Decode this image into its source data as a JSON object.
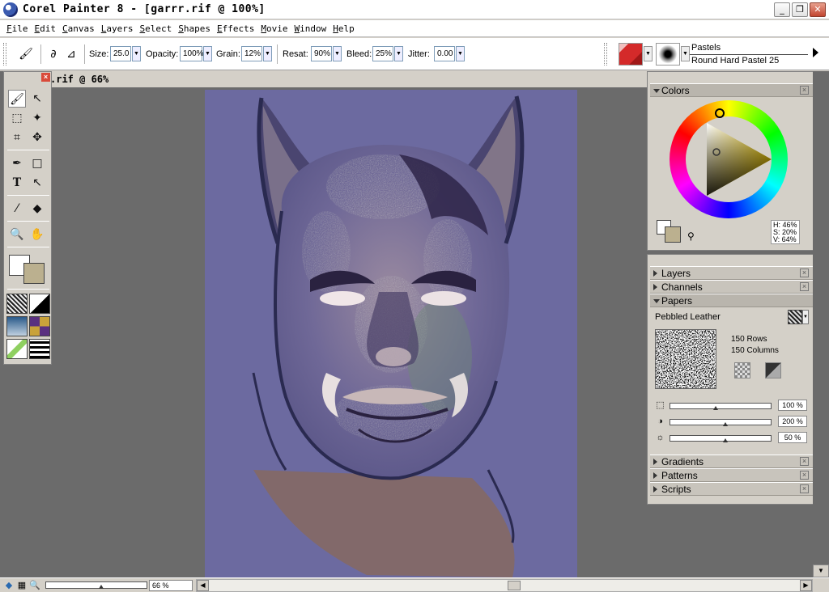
{
  "window": {
    "title": "Corel Painter 8 - [garrr.rif @ 100%]",
    "minimize_label": "_",
    "restore_label": "❐",
    "close_label": "✕"
  },
  "menu": [
    "File",
    "Edit",
    "Canvas",
    "Layers",
    "Select",
    "Shapes",
    "Effects",
    "Movie",
    "Window",
    "Help"
  ],
  "property_bar": {
    "size_label": "Size:",
    "size_value": "25.0",
    "opacity_label": "Opacity:",
    "opacity_value": "100%",
    "grain_label": "Grain:",
    "grain_value": "12%",
    "resat_label": "Resat:",
    "resat_value": "90%",
    "bleed_label": "Bleed:",
    "bleed_value": "25%",
    "jitter_label": "Jitter:",
    "jitter_value": "0.00",
    "brush_category": "Pastels",
    "brush_variant": "Round Hard Pastel 25"
  },
  "document": {
    "title": ".rif @ 66%"
  },
  "colors_palette": {
    "name": "Colors",
    "h": "H: 46%",
    "s": "S: 20%",
    "v": "V: 64%",
    "main_color": "#bbb08f",
    "additional_color": "#ffffff"
  },
  "palettes": {
    "layers": "Layers",
    "channels": "Channels",
    "papers": "Papers",
    "gradients": "Gradients",
    "patterns": "Patterns",
    "scripts": "Scripts"
  },
  "papers": {
    "paper_name": "Pebbled Leather",
    "rows": "150 Rows",
    "columns": "150 Columns",
    "scale_value": "100 %",
    "contrast_value": "200 %",
    "brightness_value": "50 %",
    "scale_level": 0.45,
    "contrast_level": 0.55,
    "brightness_level": 0.55
  },
  "status": {
    "zoom_value": "66 %",
    "zoom_level": 0.55
  },
  "icons": [
    "app-icon",
    "brush-icon",
    "arrow-select-icon",
    "rect-select-icon",
    "magic-wand-icon",
    "crop-icon",
    "layer-adjuster-icon",
    "pen-icon",
    "rectangle-icon",
    "text-icon",
    "shape-select-icon",
    "dropper-icon",
    "paint-bucket-icon",
    "magnifier-icon",
    "grabber-icon"
  ]
}
